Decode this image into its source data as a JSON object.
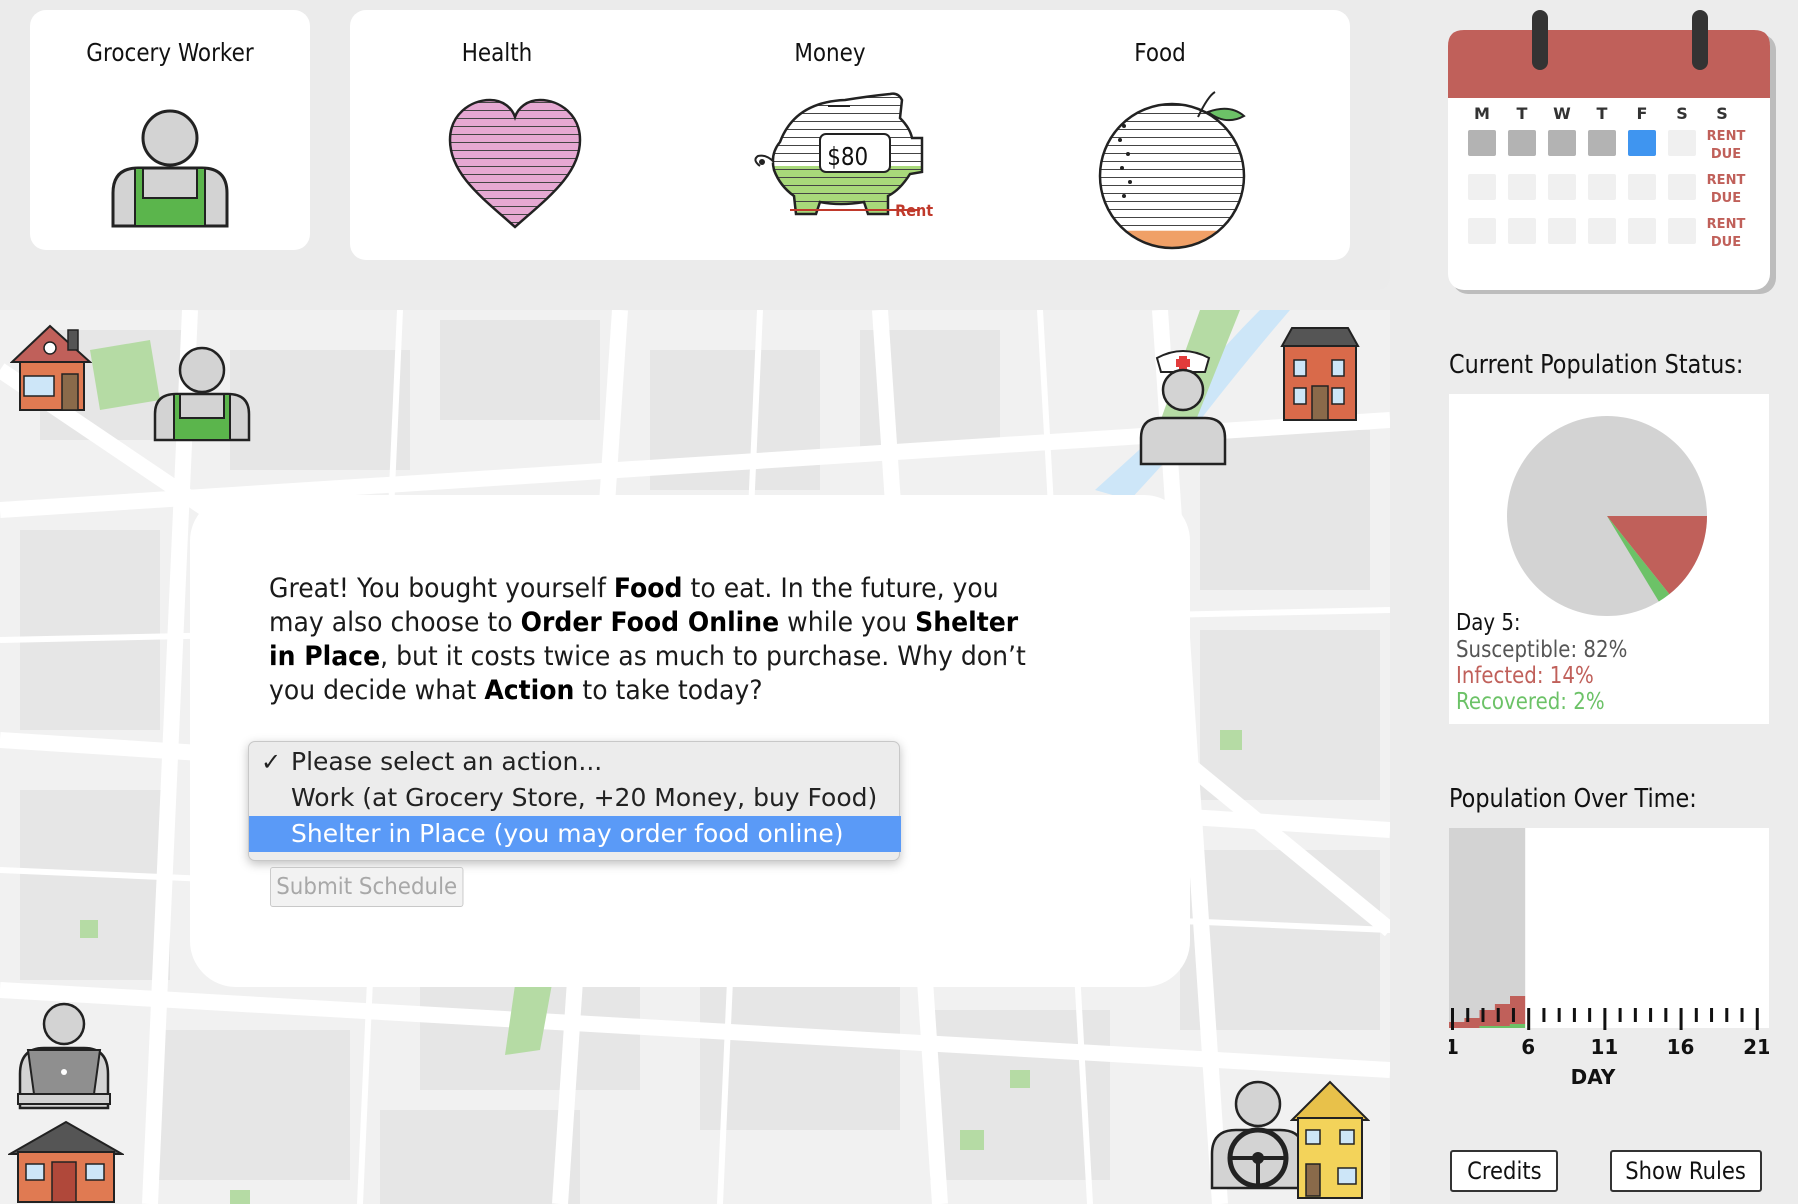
{
  "role": {
    "title": "Grocery Worker"
  },
  "stats": {
    "health_label": "Health",
    "money_label": "Money",
    "money_value": "$80",
    "rent_label": "Rent",
    "food_label": "Food",
    "health_level": 1.0,
    "money_level": 0.4,
    "food_level": 0.12
  },
  "dialog": {
    "text_parts": {
      "p1": "Great! You bought yourself ",
      "b1": "Food",
      "p2": " to eat. In the future, you may also choose to ",
      "b2": "Order Food Online",
      "p3": " while you ",
      "b3": "Shelter in Place",
      "p4": ", but it costs twice as much to purchase. Why don’t you decide what ",
      "b4": "Action",
      "p5": " to take today?"
    },
    "select": {
      "options": [
        "Please select an action...",
        "Work (at Grocery Store, +20 Money, buy Food)",
        "Shelter in Place (you may order food online)"
      ],
      "checked_index": 0,
      "highlighted_index": 2
    },
    "submit_label": "Submit Schedule"
  },
  "calendar": {
    "days": [
      "M",
      "T",
      "W",
      "T",
      "F",
      "S",
      "S"
    ],
    "rent_due_label_1": "RENT",
    "rent_due_label_2": "DUE",
    "rows": [
      [
        "past",
        "past",
        "past",
        "past",
        "today",
        "future",
        "rent"
      ],
      [
        "future",
        "future",
        "future",
        "future",
        "future",
        "future",
        "rent"
      ],
      [
        "future",
        "future",
        "future",
        "future",
        "future",
        "future",
        "rent"
      ]
    ],
    "colors": {
      "header": "#c0605a",
      "past": "#b3b3b3",
      "today": "#3f95f0",
      "future": "#f0f0f0",
      "rent_text": "#c0605a"
    }
  },
  "population_status": {
    "heading": "Current Population Status:",
    "day_label": "Day 5:",
    "susceptible_label": "Susceptible: 82%",
    "infected_label": "Infected: 14%",
    "recovered_label": "Recovered: 2%",
    "colors": {
      "susceptible": "#d3d3d3",
      "infected": "#c0605a",
      "recovered": "#6cc267"
    }
  },
  "chart_data": [
    {
      "type": "pie",
      "title": "Current Population Status:",
      "categories": [
        "Susceptible",
        "Infected",
        "Recovered"
      ],
      "values": [
        82,
        14,
        2
      ],
      "colors": [
        "#d3d3d3",
        "#c0605a",
        "#6cc267"
      ]
    },
    {
      "type": "area",
      "title": "Population Over Time:",
      "xlabel": "DAY",
      "ylabel": "",
      "x_ticks": [
        "1",
        "6",
        "11",
        "16",
        "21"
      ],
      "xlim": [
        1,
        21
      ],
      "ylim": [
        0,
        100
      ],
      "x": [
        1,
        2,
        3,
        4,
        5
      ],
      "series": [
        {
          "name": "Recovered",
          "values": [
            0,
            0,
            1,
            1,
            2
          ]
        },
        {
          "name": "Infected",
          "values": [
            3,
            5,
            8,
            11,
            14
          ]
        },
        {
          "name": "Susceptible",
          "values": [
            97,
            95,
            91,
            88,
            84
          ]
        }
      ]
    }
  ],
  "population_over_time": {
    "heading": "Population Over Time:"
  },
  "buttons": {
    "credits": "Credits",
    "show_rules": "Show Rules"
  }
}
